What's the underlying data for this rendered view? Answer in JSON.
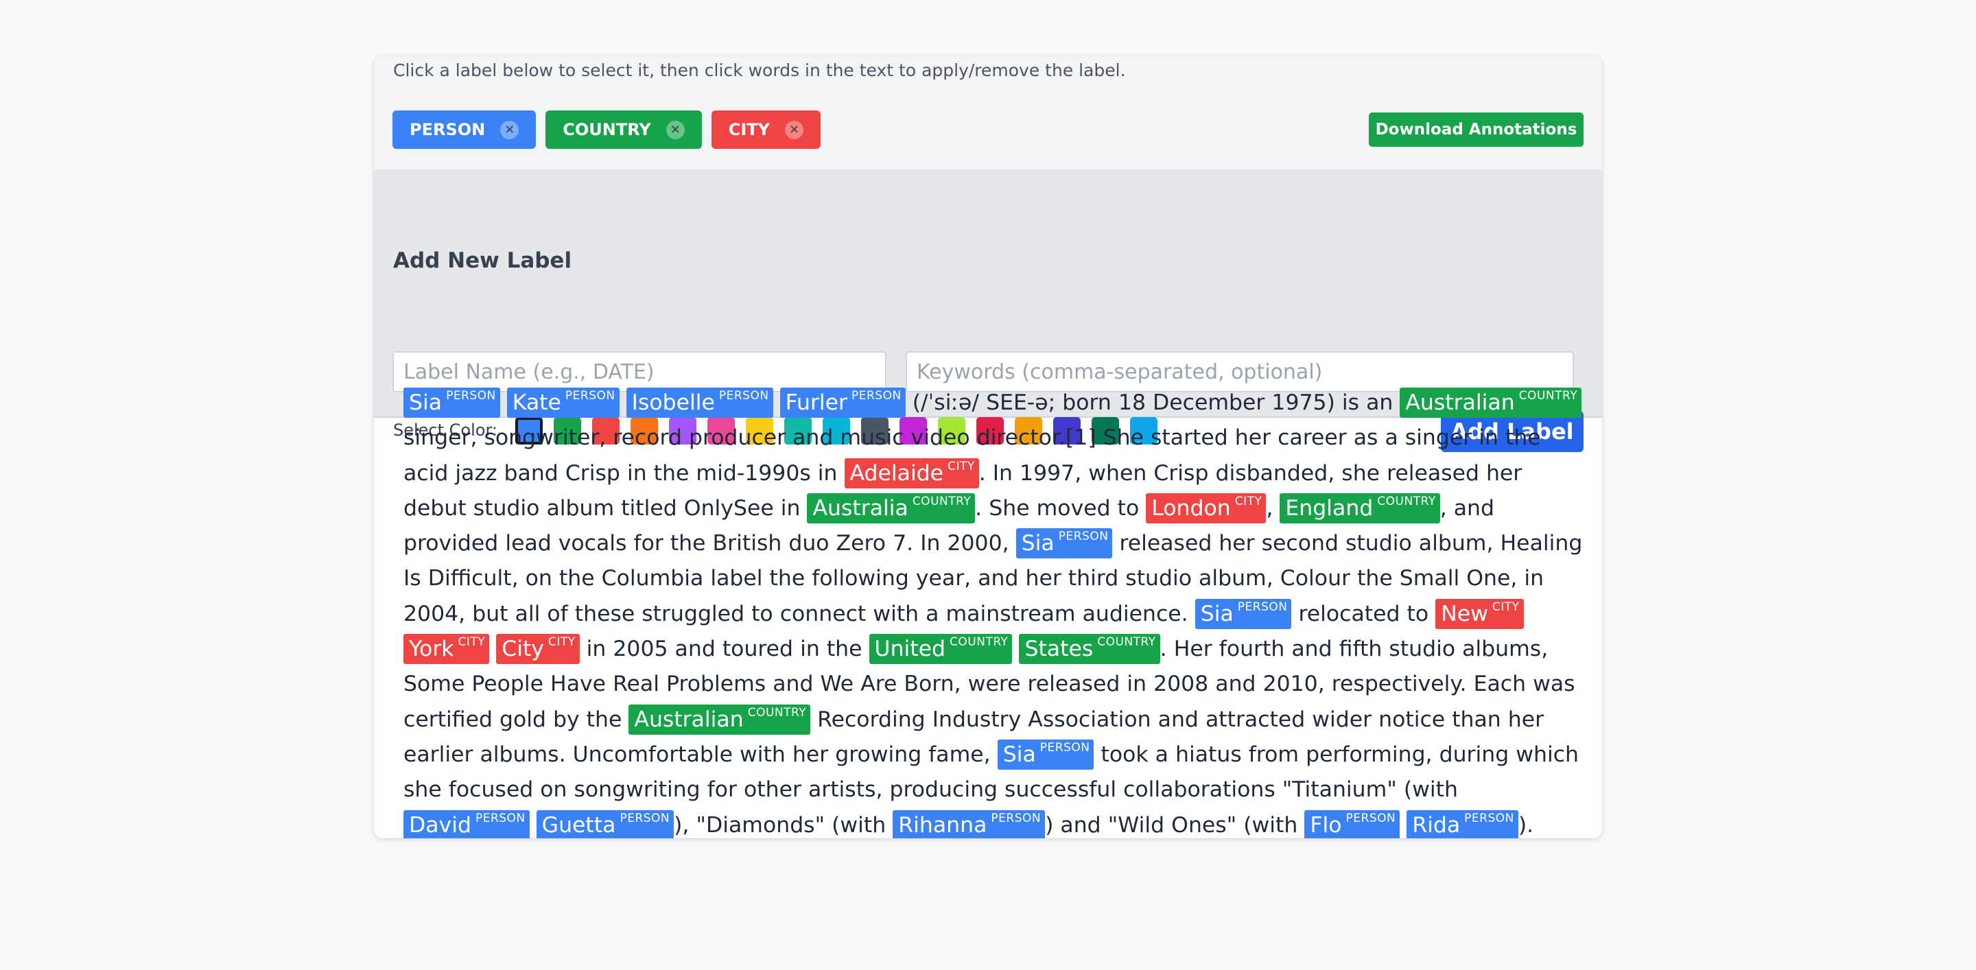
{
  "instruction": "Click a label below to select it, then click words in the text to apply/remove the label.",
  "labels": [
    {
      "name": "PERSON",
      "color": "#3b82f6"
    },
    {
      "name": "COUNTRY",
      "color": "#16a34a"
    },
    {
      "name": "CITY",
      "color": "#ef4444"
    }
  ],
  "remove_glyph": "×",
  "download_button": "Download Annotations",
  "add_section": {
    "title": "Add New Label",
    "name_placeholder": "Label Name (e.g., DATE)",
    "keywords_placeholder": "Keywords (comma-separated, optional)",
    "color_label": "Select Color:",
    "selected_color": "#3b82f6",
    "colors": [
      "#3b82f6",
      "#16a34a",
      "#ef4444",
      "#f97316",
      "#a855f7",
      "#ec4899",
      "#facc15",
      "#14b8a6",
      "#06b6d4",
      "#4b5563",
      "#c026d3",
      "#a3e635",
      "#e11d48",
      "#f59e0b",
      "#4338ca",
      "#047857",
      "#0ea5e9"
    ],
    "add_button": "Add Label"
  },
  "text_segments": [
    {
      "t": "Sia",
      "l": "PERSON"
    },
    {
      "t": " "
    },
    {
      "t": "Kate",
      "l": "PERSON"
    },
    {
      "t": " "
    },
    {
      "t": "Isobelle",
      "l": "PERSON"
    },
    {
      "t": " "
    },
    {
      "t": "Furler",
      "l": "PERSON"
    },
    {
      "t": " (/ˈsiːə/ SEE-ə; born 18 December 1975) is an "
    },
    {
      "t": "Australian",
      "l": "COUNTRY"
    },
    {
      "t": " singer, songwriter, record producer and music video director.[1] She started her career as a singer in the acid jazz band Crisp in the mid-1990s in "
    },
    {
      "t": "Adelaide",
      "l": "CITY"
    },
    {
      "t": ". In 1997, when Crisp disbanded, she released her debut studio album titled OnlySee in "
    },
    {
      "t": "Australia",
      "l": "COUNTRY"
    },
    {
      "t": ". She moved to "
    },
    {
      "t": "London",
      "l": "CITY"
    },
    {
      "t": ", "
    },
    {
      "t": "England",
      "l": "COUNTRY"
    },
    {
      "t": ", and provided lead vocals for the British duo Zero 7. In 2000, "
    },
    {
      "t": "Sia",
      "l": "PERSON"
    },
    {
      "t": " released her second studio album, Healing Is Difficult, on the Columbia label the following year, and her third studio album, Colour the Small One, in 2004, but all of these struggled to connect with a mainstream audience. "
    },
    {
      "t": "Sia",
      "l": "PERSON"
    },
    {
      "t": " relocated to "
    },
    {
      "t": "New",
      "l": "CITY"
    },
    {
      "t": " "
    },
    {
      "t": "York",
      "l": "CITY"
    },
    {
      "t": " "
    },
    {
      "t": "City",
      "l": "CITY"
    },
    {
      "t": " in 2005 and toured in the "
    },
    {
      "t": "United",
      "l": "COUNTRY"
    },
    {
      "t": " "
    },
    {
      "t": "States",
      "l": "COUNTRY"
    },
    {
      "t": ". Her fourth and fifth studio albums, Some People Have Real Problems and We Are Born, were released in 2008 and 2010, respectively. Each was certified gold by the "
    },
    {
      "t": "Australian",
      "l": "COUNTRY"
    },
    {
      "t": " Recording Industry Association and attracted wider notice than her earlier albums. Uncomfortable with her growing fame, "
    },
    {
      "t": "Sia",
      "l": "PERSON"
    },
    {
      "t": " took a hiatus from performing, during which she focused on songwriting for other artists, producing successful collaborations \"Titanium\" (with "
    },
    {
      "t": "David",
      "l": "PERSON"
    },
    {
      "t": " "
    },
    {
      "t": "Guetta",
      "l": "PERSON"
    },
    {
      "t": "), \"Diamonds\" (with "
    },
    {
      "t": "Rihanna",
      "l": "PERSON"
    },
    {
      "t": ") and \"Wild Ones\" (with "
    },
    {
      "t": "Flo",
      "l": "PERSON"
    },
    {
      "t": " "
    },
    {
      "t": "Rida",
      "l": "PERSON"
    },
    {
      "t": ")."
    }
  ]
}
